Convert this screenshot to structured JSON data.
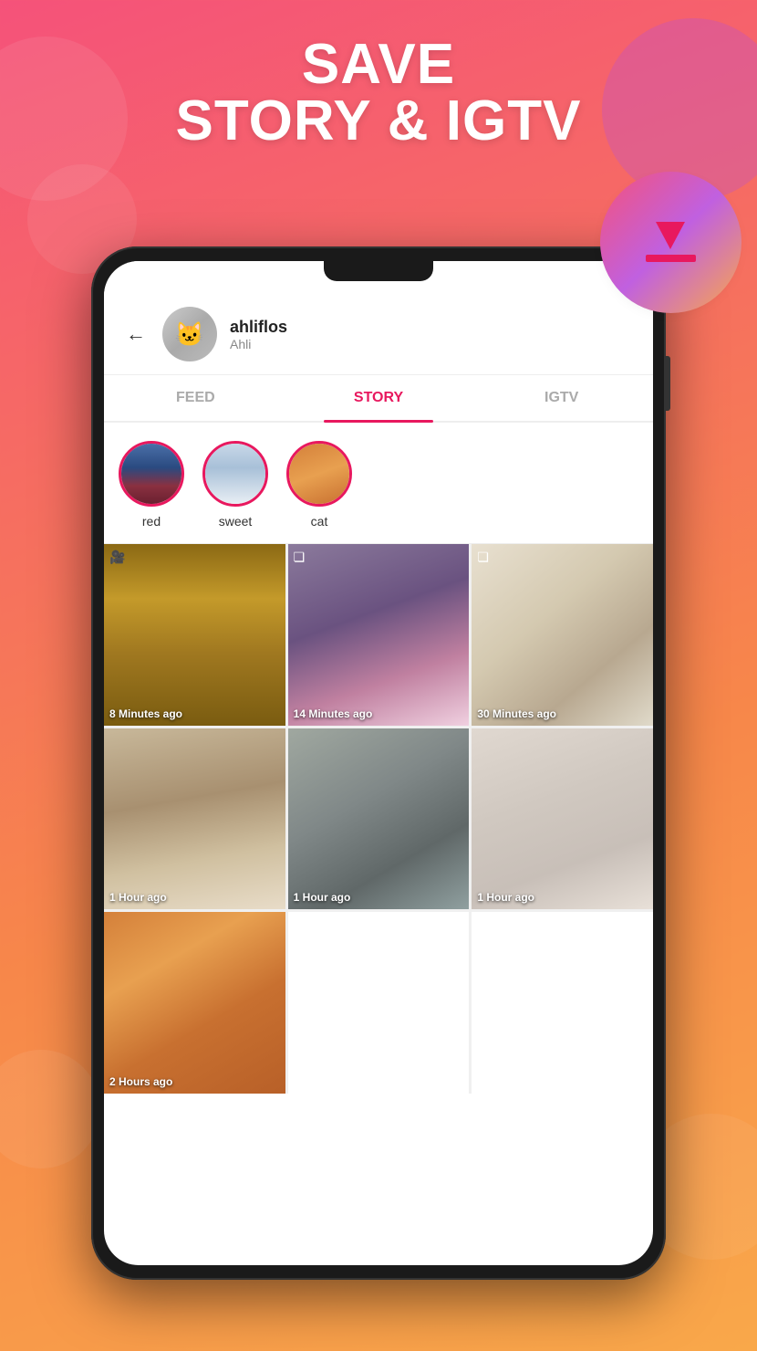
{
  "background": {
    "gradient_start": "#f5527a",
    "gradient_end": "#f9a84a"
  },
  "header": {
    "line1": "SAVE",
    "line2": "STORY & IGTV"
  },
  "profile": {
    "username": "ahliflos",
    "display_name": "Ahli"
  },
  "tabs": [
    {
      "label": "FEED",
      "active": false
    },
    {
      "label": "STORY",
      "active": true
    },
    {
      "label": "IGTV",
      "active": false
    }
  ],
  "stories": [
    {
      "label": "red"
    },
    {
      "label": "sweet"
    },
    {
      "label": "cat"
    }
  ],
  "media_items": [
    {
      "time": "8 Minutes ago",
      "has_video_icon": true,
      "has_multi_icon": false
    },
    {
      "time": "14 Minutes ago",
      "has_video_icon": false,
      "has_multi_icon": true
    },
    {
      "time": "30 Minutes ago",
      "has_video_icon": false,
      "has_multi_icon": true
    },
    {
      "time": "1 Hour ago",
      "has_video_icon": false,
      "has_multi_icon": false
    },
    {
      "time": "1 Hour ago",
      "has_video_icon": false,
      "has_multi_icon": false
    },
    {
      "time": "1 Hour ago",
      "has_video_icon": false,
      "has_multi_icon": false
    },
    {
      "time": "2 Hours ago",
      "has_video_icon": false,
      "has_multi_icon": false
    }
  ],
  "back_button": "←"
}
